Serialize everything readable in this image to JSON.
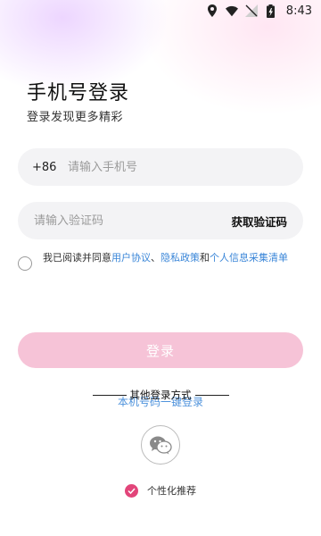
{
  "status_bar": {
    "time": "8:43",
    "icons": [
      "location-icon",
      "wifi-icon",
      "signal-icon",
      "battery-icon"
    ]
  },
  "header": {
    "title": "手机号登录",
    "subtitle": "登录发现更多精彩"
  },
  "phone_field": {
    "prefix": "+86",
    "placeholder": "请输入手机号",
    "value": ""
  },
  "code_field": {
    "placeholder": "请输入验证码",
    "value": "",
    "get_code_label": "获取验证码"
  },
  "agreement": {
    "checked": false,
    "prefix_text": "我已阅读并同意",
    "link_user": "用户协议",
    "sep1": "、",
    "link_privacy": "隐私政策",
    "sep2": "和",
    "link_personal": "个人信息采集清单"
  },
  "login_button": {
    "label": "登录",
    "color": "#f6c3d7"
  },
  "other_login": {
    "title": "其他登录方式",
    "one_key_label": "本机号码一键登录",
    "wechat_icon": "wechat-icon"
  },
  "personalized": {
    "checked": true,
    "label": "个性化推荐",
    "color": "#e2457a"
  },
  "colors": {
    "link": "#3a86d8",
    "field_bg": "#f3f3f5"
  }
}
